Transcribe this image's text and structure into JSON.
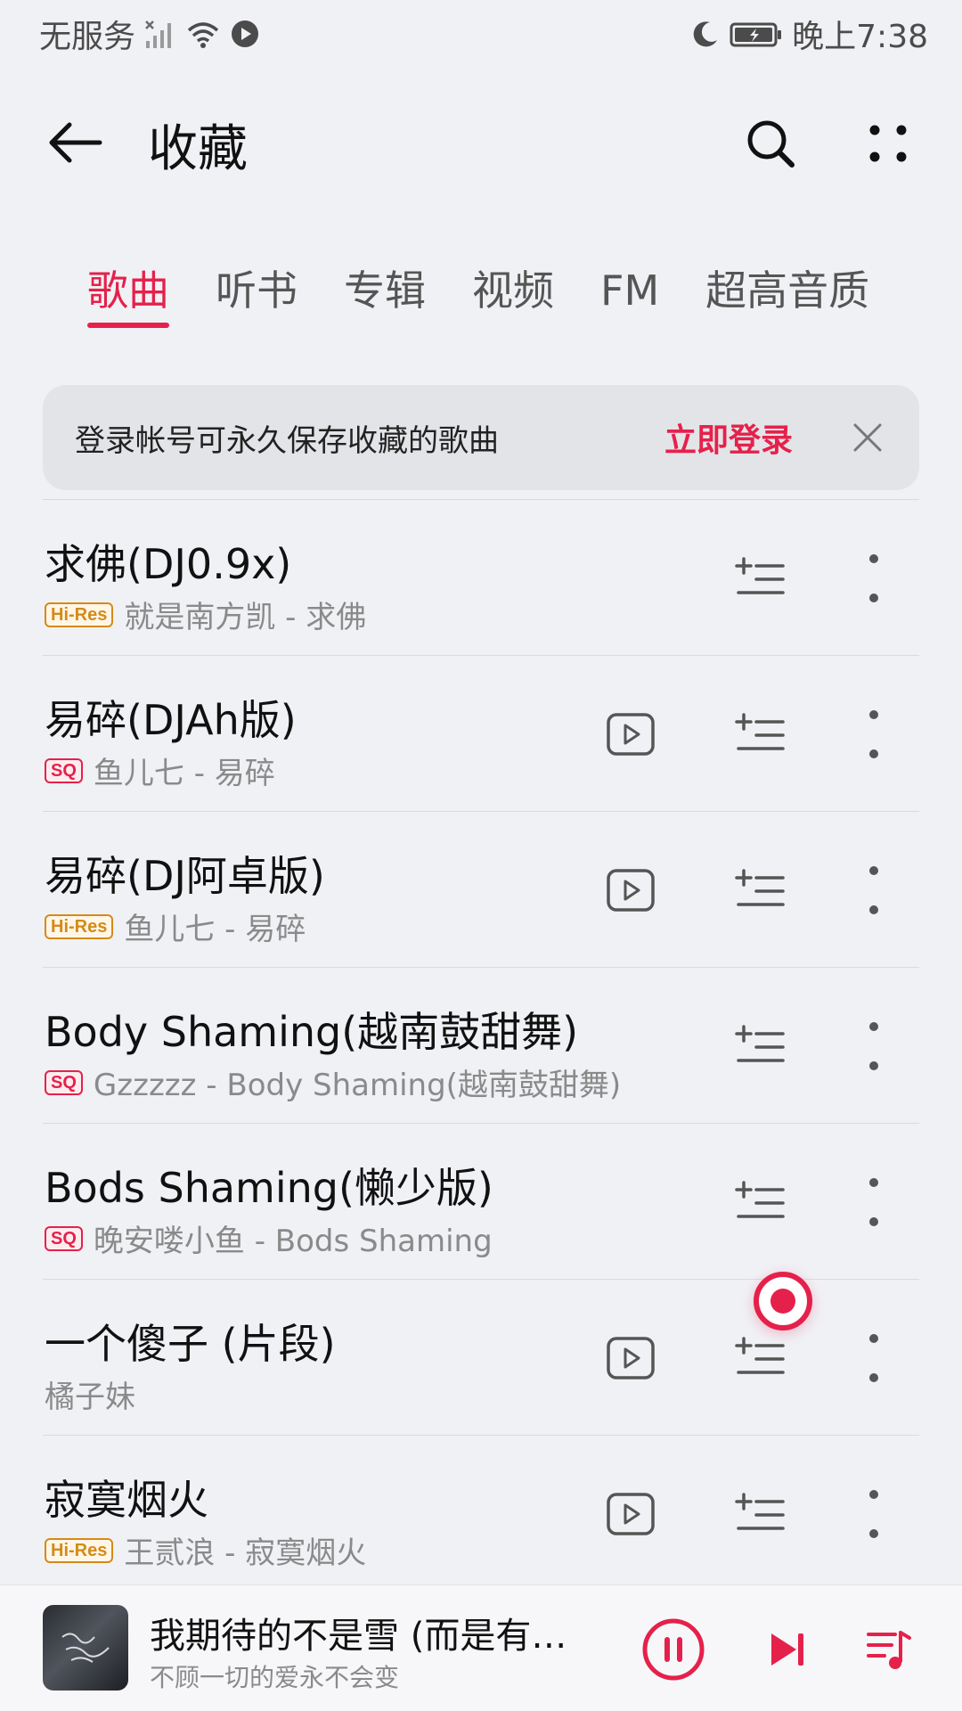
{
  "status_bar": {
    "carrier": "无服务",
    "time": "晚上7:38",
    "icons": [
      "signal-icon",
      "wifi-icon",
      "play-status-icon",
      "moon-icon",
      "battery-icon"
    ]
  },
  "header": {
    "title": "收藏",
    "back_icon": "arrow-left-icon",
    "search_icon": "search-icon",
    "more_icon": "more-dots-icon"
  },
  "tabs": [
    {
      "label": "歌曲",
      "active": true
    },
    {
      "label": "听书",
      "active": false
    },
    {
      "label": "专辑",
      "active": false
    },
    {
      "label": "视频",
      "active": false
    },
    {
      "label": "FM",
      "active": false
    },
    {
      "label": "超高音质",
      "active": false
    }
  ],
  "login_banner": {
    "text": "登录帐号可永久保存收藏的歌曲",
    "action": "立即登录",
    "close_icon": "close-icon"
  },
  "songs": [
    {
      "title": "求佛(DJ0.9x)",
      "badge": "Hi-Res",
      "meta": "就是南方凯 - 求佛",
      "has_mv": false
    },
    {
      "title": "易碎(DJAh版)",
      "badge": "SQ",
      "meta": "鱼儿七 - 易碎",
      "has_mv": true
    },
    {
      "title": "易碎(DJ阿卓版)",
      "badge": "Hi-Res",
      "meta": "鱼儿七 - 易碎",
      "has_mv": true
    },
    {
      "title": "Body Shaming(越南鼓甜舞)",
      "badge": "SQ",
      "meta": "Gzzzzz - Body Shaming(越南鼓甜舞)",
      "has_mv": false
    },
    {
      "title": "Bods Shaming(懒少版)",
      "badge": "SQ",
      "meta": "晚安喽小鱼 - Bods Shaming",
      "has_mv": false
    },
    {
      "title": "一个傻子 (片段)",
      "badge": "",
      "meta": "橘子妹",
      "has_mv": true
    },
    {
      "title": "寂寞烟火",
      "badge": "Hi-Res",
      "meta": "王贰浪 - 寂寞烟火",
      "has_mv": true
    }
  ],
  "now_playing": {
    "title": "我期待的不是雪 (而是有…",
    "subtitle": "不顾一切的爱永不会变",
    "controls": [
      "pause-icon",
      "next-icon",
      "playlist-icon"
    ]
  },
  "colors": {
    "accent": "#e5214b",
    "hires_badge": "#d58a1a",
    "background": "#f0f1f5"
  }
}
